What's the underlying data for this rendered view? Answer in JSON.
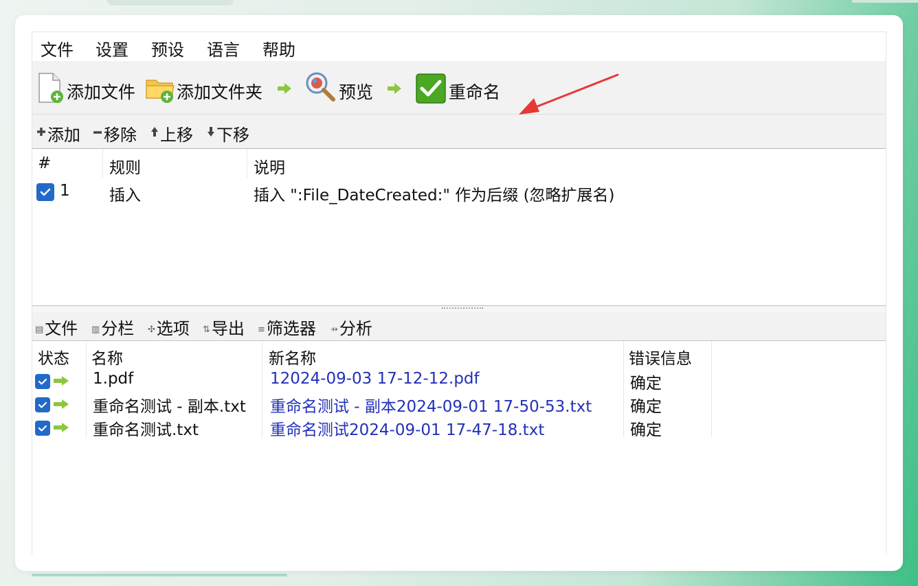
{
  "menu": [
    "文件",
    "设置",
    "预设",
    "语言",
    "帮助"
  ],
  "toolbar": {
    "add_files": "添加文件",
    "add_folder": "添加文件夹",
    "preview": "预览",
    "rename": "重命名"
  },
  "rules_toolbar": {
    "add": "添加",
    "remove": "移除",
    "move_up": "上移",
    "move_down": "下移"
  },
  "rules_table": {
    "headers": {
      "num": "#",
      "rule": "规则",
      "desc": "说明"
    },
    "rows": [
      {
        "num": "1",
        "rule": "插入",
        "desc": "插入 \":File_DateCreated:\" 作为后缀 (忽略扩展名)",
        "checked": true
      }
    ]
  },
  "files_toolbar": {
    "files": "文件",
    "columns": "分栏",
    "options": "选项",
    "export": "导出",
    "filter": "筛选器",
    "analyze": "分析"
  },
  "files_table": {
    "headers": {
      "status": "状态",
      "name": "名称",
      "new_name": "新名称",
      "error": "错误信息"
    },
    "rows": [
      {
        "name": "1.pdf",
        "new_name": "12024-09-03 17-12-12.pdf",
        "error": "确定"
      },
      {
        "name": "重命名测试 - 副本.txt",
        "new_name": "重命名测试 - 副本2024-09-01 17-50-53.txt",
        "error": "确定"
      },
      {
        "name": "重命名测试.txt",
        "new_name": "重命名测试2024-09-01 17-47-18.txt",
        "error": "确定"
      }
    ]
  },
  "colors": {
    "checkbox": "#2369c9",
    "new_name_text": "#2230b8",
    "arrow_green": "#8cc63f",
    "annotation_arrow": "#e53935"
  }
}
